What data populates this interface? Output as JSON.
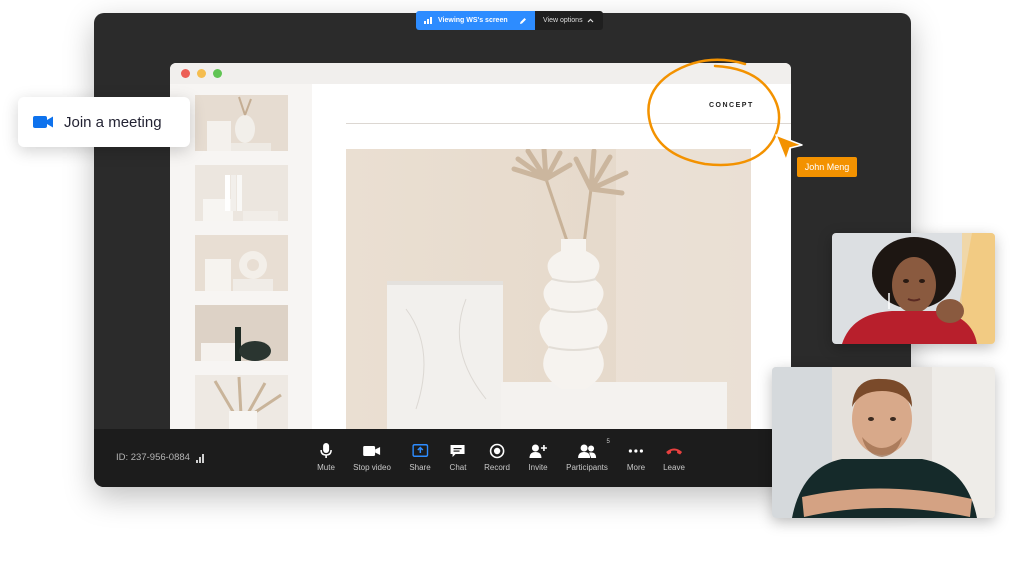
{
  "share_banner": {
    "viewing_label": "Viewing WS's screen",
    "view_options_label": "View options"
  },
  "document": {
    "heading": "CONCEPT"
  },
  "annotation": {
    "cursor_name": "John Meng"
  },
  "join_card": {
    "label": "Join a meeting"
  },
  "control_bar": {
    "meeting_id": "ID: 237-956-0884",
    "participants_count": "5",
    "controls": [
      {
        "label": "Mute"
      },
      {
        "label": "Stop video"
      },
      {
        "label": "Share"
      },
      {
        "label": "Chat"
      },
      {
        "label": "Record"
      },
      {
        "label": "Invite"
      },
      {
        "label": "Participants"
      },
      {
        "label": "More"
      },
      {
        "label": "Leave"
      }
    ]
  },
  "colors": {
    "accent_blue": "#2d8cff",
    "annotation_orange": "#f39200",
    "leave_red": "#e8403f",
    "window_bg": "#2b2b2b"
  }
}
